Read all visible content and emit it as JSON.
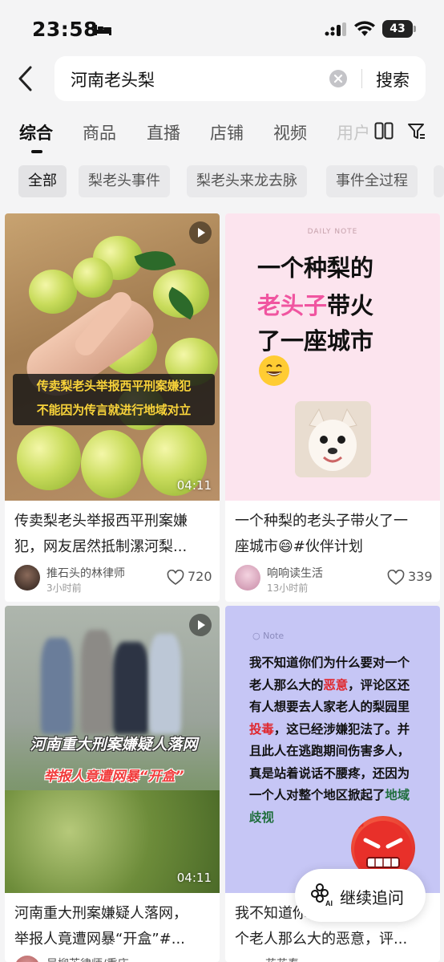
{
  "status_bar": {
    "time": "23:58",
    "battery": "43"
  },
  "search": {
    "query": "河南老头梨",
    "button_label": "搜索"
  },
  "tabs": [
    {
      "label": "综合",
      "active": true
    },
    {
      "label": "商品"
    },
    {
      "label": "直播"
    },
    {
      "label": "店铺"
    },
    {
      "label": "视频"
    },
    {
      "label": "用户"
    }
  ],
  "chips": [
    "全部",
    "梨老头事件",
    "梨老头来龙去脉",
    "事件全过程"
  ],
  "cards": [
    {
      "title_line1": "传卖梨老头举报西平刑案嫌",
      "title_line2": "犯，网友居然抵制漯河梨...",
      "overlay_line1": "传卖梨老头举报西平刑案嫌犯",
      "overlay_line2": "不能因为传言就进行地域对立",
      "duration": "04:11",
      "author": "推石头的林律师",
      "time_ago": "3小时前",
      "likes": "720"
    },
    {
      "title_line1": "一个种梨的老头子带火了一",
      "title_line2": "座城市😄#伙伴计划",
      "tag": "DAILY NOTE",
      "big_line1": "一个种梨的",
      "big_line2a": "老头子",
      "big_line2b": "带火",
      "big_line3": "了一座城市",
      "author": "响响读生活",
      "time_ago": "13小时前",
      "likes": "339"
    },
    {
      "title_line1": "河南重大刑案嫌疑人落网，",
      "title_line2": "举报人竟遭网暴“开盒”#...",
      "overlay_line1": "河南重大刑案嫌疑人落网",
      "overlay_line2": "举报人竟遭网暴“开盒”",
      "duration": "04:11",
      "author": "吴柳芳律师/重庆"
    },
    {
      "title_line1": "我不知道你们为什么要对一",
      "title_line2": "个老人那么大的恶意，评...",
      "note_label": "Note",
      "p1": "我不知道你们为什么要对一个老人那么大的",
      "p2": "恶意",
      "p3": "，评论区还有人想要去人家老人的梨园里",
      "p4": "投毒",
      "p5": "，这已经涉嫌犯法了。并且此人在逃跑期间伤害多人，真是站着说话不腰疼，还因为一个人对整个地区掀起了",
      "p6": "地域歧视",
      "author": "花花春"
    }
  ],
  "fab": {
    "label": "继续追问"
  },
  "colors": {
    "accent_pink": "#f055a0",
    "red_text": "#e0262c",
    "green_text": "#1f6e3c",
    "banner_yellow": "#f8d33a"
  }
}
